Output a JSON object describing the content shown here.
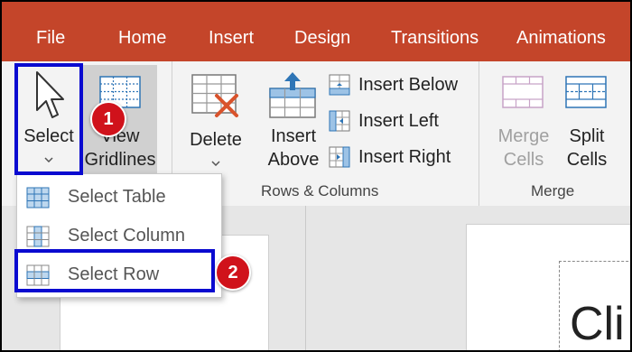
{
  "tabs": [
    "File",
    "Home",
    "Insert",
    "Design",
    "Transitions",
    "Animations"
  ],
  "ribbon": {
    "select_label": "Select",
    "view_gridlines_line1": "View",
    "view_gridlines_line2": "Gridlines",
    "delete_label": "Delete",
    "insert_above_line1": "Insert",
    "insert_above_line2": "Above",
    "insert_below": "Insert Below",
    "insert_left": "Insert Left",
    "insert_right": "Insert Right",
    "merge_cells_line1": "Merge",
    "merge_cells_line2": "Cells",
    "split_cells_line1": "Split",
    "split_cells_line2": "Cells",
    "group_rows_columns": "Rows & Columns",
    "group_merge": "Merge"
  },
  "dropdown": {
    "items": [
      "Select Table",
      "Select Column",
      "Select Row"
    ]
  },
  "annotations": {
    "step1": "1",
    "step2": "2"
  },
  "slide": {
    "title_fragment": "Cli"
  },
  "colors": {
    "tab_bar": "#c4452a",
    "highlight": "#0a0ad0",
    "badge": "#d0121b",
    "accent_blue": "#2e75b6"
  }
}
